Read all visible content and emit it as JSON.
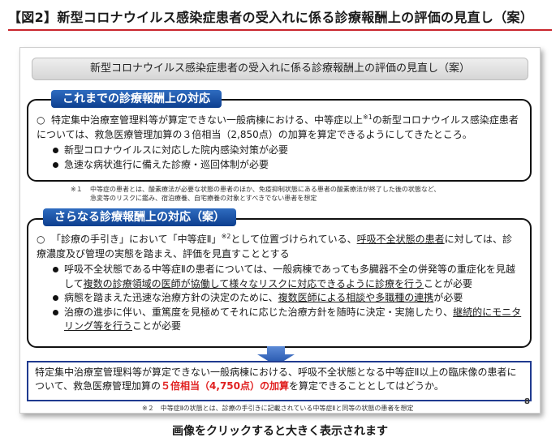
{
  "page_title": "【図2】新型コロナウイルス感染症患者の受入れに係る診療報酬上の評価の見直し（案）",
  "slide": {
    "header": "新型コロナウイルス感染症患者の受入れに係る診療報酬上の評価の見直し（案）",
    "section1": {
      "label": "これまでの診療報酬上の対応",
      "bullet": "○",
      "para_a": "特定集中治療室管理料等が算定できない一般病棟における、中等症以上",
      "para_sup": "※1",
      "para_b": "の新型コロナウイルス感染症患者については、救急医療管理加算の３倍相当（2,850点）の加算を算定できるようにしてきたところ。",
      "items": [
        "新型コロナウイルスに対応した院内感染対策が必要",
        "急速な病状進行に備えた診療・巡回体制が必要"
      ]
    },
    "footnote1": {
      "mark": "※１",
      "line1": "中等症の患者とは、酸素療法が必要な状態の患者のほか、免疫抑制状態にある患者の酸素療法が終了した後の状態など、",
      "line2": "急変等のリスクに鑑み、宿泊療養、自宅療養の対象とすべきでない患者を想定"
    },
    "section2": {
      "label": "さらなる診療報酬上の対応（案）",
      "bullet": "○",
      "para_a": "「診療の手引き」において「中等症Ⅱ」",
      "para_sup": "※2",
      "para_b": "として位置づけられている、",
      "para_u": "呼吸不全状態の患者",
      "para_c": "に対しては、診療濃度及び管理の実態を踏まえ、評価を見直すこととする",
      "item1_a": "呼吸不全状態である中等症Ⅱの患者については、一般病棟であっても多臓器不全の併発等の重症化を見越して",
      "item1_u": "複数の診療領域の医師が協働して様々なリスクに対応できるように診療を行う",
      "item1_b": "ことが必要",
      "item2_a": "病態を踏まえた迅速な治療方針の決定のために、",
      "item2_u": "複数医師による相談や多職種の連携",
      "item2_b": "が必要",
      "item3_a": "治療の進歩に伴い、重篤度を見極めてそれに応じた治療方針を随時に決定・実施したり、",
      "item3_u": "継続的にモニタリング等を行う",
      "item3_b": "ことが必要"
    },
    "conclusion": {
      "text_a": "特定集中治療室管理料等が算定できない一般病棟における、呼吸不全状態となる中等症Ⅱ以上の臨床像の患者について、救急医療管理加算の",
      "text_red": "５倍相当（4,750点）の加算",
      "text_b": "を算定できることとしてはどうか。"
    },
    "footnote2": "※２　中等症Ⅱの状態とは、診療の手引きに記載されている中等症Ⅱと同等の状態の患者を想定",
    "page_number": "8"
  },
  "caption": "画像をクリックすると大きく表示されます",
  "colors": {
    "accent_red": "#c9252c",
    "label_blue": "#0d3f8f",
    "highlight_red": "#e02020",
    "frame_navy": "#1f3a8f"
  }
}
